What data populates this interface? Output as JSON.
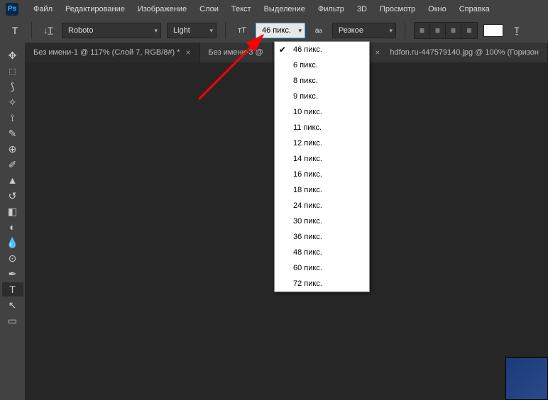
{
  "menu": {
    "items": [
      "Файл",
      "Редактирование",
      "Изображение",
      "Слои",
      "Текст",
      "Выделение",
      "Фильтр",
      "3D",
      "Просмотр",
      "Окно",
      "Справка"
    ]
  },
  "optbar": {
    "font": "Roboto",
    "weight": "Light",
    "size": "46 пикс.",
    "aa": "Резкое"
  },
  "tabs": [
    {
      "label": "Без имени-1 @ 117% (Слой 7, RGB/8#) *"
    },
    {
      "label": "Без имени-3 @"
    },
    {
      "label": "hdfon.ru-447579140.jpg @ 100% (Горизон"
    }
  ],
  "sizes": {
    "selected": "46 пикс.",
    "list": [
      "46 пикс.",
      "6 пикс.",
      "8 пикс.",
      "9 пикс.",
      "10 пикс.",
      "11 пикс.",
      "12 пикс.",
      "14 пикс.",
      "16 пикс.",
      "18 пикс.",
      "24 пикс.",
      "30 пикс.",
      "36 пикс.",
      "48 пикс.",
      "60 пикс.",
      "72 пикс."
    ]
  },
  "logo": "Ps"
}
